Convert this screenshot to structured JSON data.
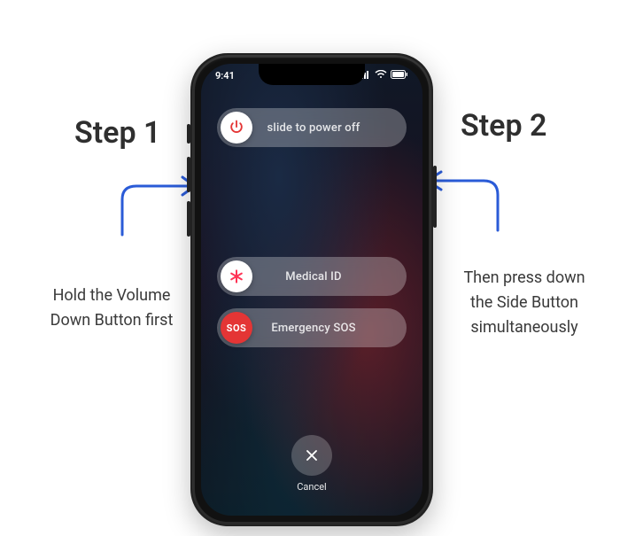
{
  "status": {
    "time": "9:41"
  },
  "sliders": {
    "power": {
      "label": "slide to power off",
      "icon": "power-icon"
    },
    "medical": {
      "label": "Medical ID",
      "icon": "asterisk-icon"
    },
    "sos": {
      "label": "Emergency SOS",
      "icon": "sos-text",
      "knob_text": "SOS"
    }
  },
  "cancel": {
    "label": "Cancel"
  },
  "annotations": {
    "step1": {
      "title": "Step 1",
      "text": "Hold the Volume Down Button first"
    },
    "step2": {
      "title": "Step 2",
      "text": "Then press down the Side Button simultaneously"
    }
  }
}
